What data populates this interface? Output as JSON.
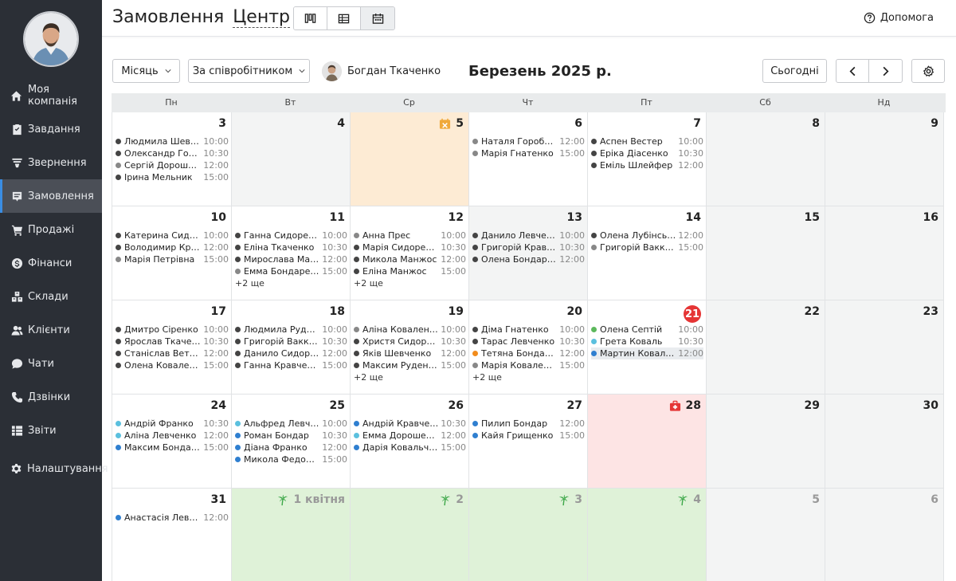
{
  "sidebar": {
    "items": [
      {
        "label": "Моя компанія",
        "icon": "home-icon"
      },
      {
        "label": "Завдання",
        "icon": "clipboard-icon"
      },
      {
        "label": "Звернення",
        "icon": "funnel-icon"
      },
      {
        "label": "Замовлення",
        "icon": "orders-icon",
        "active": true
      },
      {
        "label": "Продажі",
        "icon": "cart-icon"
      },
      {
        "label": "Фінанси",
        "icon": "dollar-icon"
      },
      {
        "label": "Склади",
        "icon": "boxes-icon"
      },
      {
        "label": "Клієнти",
        "icon": "users-icon"
      },
      {
        "label": "Чати",
        "icon": "chat-icon"
      },
      {
        "label": "Дзвінки",
        "icon": "phone-icon"
      },
      {
        "label": "Звіти",
        "icon": "reports-icon"
      },
      {
        "label": "Налаштування",
        "icon": "gear-icon"
      }
    ]
  },
  "header": {
    "title": "Замовлення",
    "location": "Центр",
    "help": "Допомога"
  },
  "toolbar": {
    "period": "Місяць",
    "grouping": "За співробітником",
    "employee": "Богдан Ткаченко",
    "month_title": "Березень 2025 р.",
    "today": "Сьогодні"
  },
  "calendar": {
    "weekdays": [
      "Пн",
      "Вт",
      "Ср",
      "Чт",
      "Пт",
      "Сб",
      "Нд"
    ],
    "weeks": [
      [
        {
          "day": "3",
          "events": [
            {
              "name": "Людмила Шевченко",
              "time": "10:00",
              "color": "#444"
            },
            {
              "name": "Олександр Гончар",
              "time": "10:30",
              "color": "#444"
            },
            {
              "name": "Сергій Дорошенко",
              "time": "12:00",
              "color": "#888"
            },
            {
              "name": "Ірина Мельник",
              "time": "15:00",
              "color": "#444"
            }
          ]
        },
        {
          "day": "4",
          "state": "past",
          "events": []
        },
        {
          "day": "5",
          "state": "vacation",
          "icon": "vacation-icon",
          "events": []
        },
        {
          "day": "6",
          "events": [
            {
              "name": "Наталя Горобець",
              "time": "12:00",
              "color": "#888"
            },
            {
              "name": "Марія Гнатенко",
              "time": "15:00",
              "color": "#888"
            }
          ]
        },
        {
          "day": "7",
          "events": [
            {
              "name": "Аспен Вестер",
              "time": "10:00",
              "color": "#444"
            },
            {
              "name": "Еріка Діасенко",
              "time": "10:30",
              "color": "#444"
            },
            {
              "name": "Еміль Шлейфер",
              "time": "12:00",
              "color": "#444"
            }
          ]
        },
        {
          "day": "8",
          "state": "weekend",
          "events": []
        },
        {
          "day": "9",
          "state": "weekend",
          "events": []
        }
      ],
      [
        {
          "day": "10",
          "events": [
            {
              "name": "Катерина Сидоренко",
              "time": "10:00",
              "color": "#444"
            },
            {
              "name": "Володимир Кравченко",
              "time": "12:00",
              "color": "#444"
            },
            {
              "name": "Марія Петрівна",
              "time": "15:00",
              "color": "#888"
            }
          ]
        },
        {
          "day": "11",
          "events": [
            {
              "name": "Ганна Сидоренко",
              "time": "10:00",
              "color": "#444"
            },
            {
              "name": "Еліна Ткаченко",
              "time": "10:30",
              "color": "#444"
            },
            {
              "name": "Мирослава Манжос",
              "time": "12:00",
              "color": "#444"
            },
            {
              "name": "Емма Бондаренко",
              "time": "15:00",
              "color": "#888"
            }
          ],
          "more": "+2 ще"
        },
        {
          "day": "12",
          "events": [
            {
              "name": "Анна Прес",
              "time": "10:00",
              "color": "#888"
            },
            {
              "name": "Марія Сидоренко",
              "time": "10:30",
              "color": "#444"
            },
            {
              "name": "Микола Манжос",
              "time": "12:00",
              "color": "#444"
            },
            {
              "name": "Еліна Манжос",
              "time": "15:00",
              "color": "#444"
            }
          ],
          "more": "+2 ще"
        },
        {
          "day": "13",
          "state": "past",
          "events": [
            {
              "name": "Данило Левченко",
              "time": "10:00",
              "color": "#444"
            },
            {
              "name": "Григорій Кравець",
              "time": "10:30",
              "color": "#444"
            },
            {
              "name": "Олена Бондаренко",
              "time": "12:00",
              "color": "#444"
            }
          ]
        },
        {
          "day": "14",
          "events": [
            {
              "name": "Олена Лубінська",
              "time": "12:00",
              "color": "#444"
            },
            {
              "name": "Григорій Ваккар",
              "time": "15:00",
              "color": "#888"
            }
          ]
        },
        {
          "day": "15",
          "state": "weekend",
          "events": []
        },
        {
          "day": "16",
          "state": "weekend",
          "events": []
        }
      ],
      [
        {
          "day": "17",
          "events": [
            {
              "name": "Дмитро Сіренко",
              "time": "10:00",
              "color": "#444"
            },
            {
              "name": "Ярослав Ткаченко",
              "time": "10:30",
              "color": "#444"
            },
            {
              "name": "Станіслав Ветров",
              "time": "12:00",
              "color": "#444"
            },
            {
              "name": "Олена Коваленко",
              "time": "15:00",
              "color": "#444"
            }
          ]
        },
        {
          "day": "18",
          "events": [
            {
              "name": "Людмила Руденко",
              "time": "10:00",
              "color": "#444"
            },
            {
              "name": "Григорій Ваккаро",
              "time": "10:30",
              "color": "#444"
            },
            {
              "name": "Данило Сидоренко",
              "time": "12:00",
              "color": "#444"
            },
            {
              "name": "Ганна Кравченко",
              "time": "15:00",
              "color": "#444"
            }
          ]
        },
        {
          "day": "19",
          "events": [
            {
              "name": "Аліна Коваленко",
              "time": "10:00",
              "color": "#888"
            },
            {
              "name": "Христя Сидоренко",
              "time": "10:30",
              "color": "#444"
            },
            {
              "name": "Яків Шевченко",
              "time": "12:00",
              "color": "#444"
            },
            {
              "name": "Максим Руденко",
              "time": "15:00",
              "color": "#444"
            }
          ],
          "more": "+2 ще"
        },
        {
          "day": "20",
          "events": [
            {
              "name": "Діма Гнатенко",
              "time": "10:00",
              "color": "#444"
            },
            {
              "name": "Тарас Левченко",
              "time": "10:30",
              "color": "#444"
            },
            {
              "name": "Тетяна Бондаренко",
              "time": "12:00",
              "color": "#f28c1c"
            },
            {
              "name": "Марія Коваленко",
              "time": "15:00",
              "color": "#888"
            }
          ],
          "more": "+2 ще"
        },
        {
          "day": "21",
          "today": true,
          "events": [
            {
              "name": "Олена Септій",
              "time": "10:00",
              "color": "#5cb85c"
            },
            {
              "name": "Грета Коваль",
              "time": "10:30",
              "color": "#5bc0de"
            },
            {
              "name": "Мартин Коваленко",
              "time": "12:00",
              "color": "#2f7fd0",
              "highlight": true
            }
          ]
        },
        {
          "day": "22",
          "state": "weekend",
          "events": []
        },
        {
          "day": "23",
          "state": "weekend",
          "events": []
        }
      ],
      [
        {
          "day": "24",
          "events": [
            {
              "name": "Андрій Франко",
              "time": "10:30",
              "color": "#5bc0de"
            },
            {
              "name": "Аліна Левченко",
              "time": "12:00",
              "color": "#5bc0de"
            },
            {
              "name": "Максим Бондаренко",
              "time": "15:00",
              "color": "#2f7fd0"
            }
          ]
        },
        {
          "day": "25",
          "events": [
            {
              "name": "Альфред Левченко",
              "time": "10:00",
              "color": "#5bc0de"
            },
            {
              "name": "Роман Бондар",
              "time": "10:30",
              "color": "#2f7fd0"
            },
            {
              "name": "Діана Франко",
              "time": "12:00",
              "color": "#2f7fd0"
            },
            {
              "name": "Микола Федоренко",
              "time": "15:00",
              "color": "#2f7fd0"
            }
          ]
        },
        {
          "day": "26",
          "events": [
            {
              "name": "Андрій Кравченко",
              "time": "10:30",
              "color": "#2f7fd0"
            },
            {
              "name": "Емма Дорошенко",
              "time": "12:00",
              "color": "#5bc0de"
            },
            {
              "name": "Дарія Ковальчук",
              "time": "15:00",
              "color": "#2f7fd0"
            }
          ]
        },
        {
          "day": "27",
          "events": [
            {
              "name": "Пилип Бондар",
              "time": "12:00",
              "color": "#2f7fd0"
            },
            {
              "name": "Кайя Грищенко",
              "time": "15:00",
              "color": "#2f7fd0"
            }
          ]
        },
        {
          "day": "28",
          "state": "sick",
          "icon": "medical-kit-icon",
          "events": []
        },
        {
          "day": "29",
          "state": "weekend",
          "events": []
        },
        {
          "day": "30",
          "state": "weekend",
          "events": []
        }
      ],
      [
        {
          "day": "31",
          "events": [
            {
              "name": "Анастасія Левченко",
              "time": "12:00",
              "color": "#2f7fd0"
            }
          ]
        },
        {
          "day": "1 квітня",
          "state": "holiday",
          "other": true,
          "icon": "palm-tree-icon",
          "events": []
        },
        {
          "day": "2",
          "state": "holiday",
          "other": true,
          "icon": "palm-tree-icon",
          "events": []
        },
        {
          "day": "3",
          "state": "holiday",
          "other": true,
          "icon": "palm-tree-icon",
          "events": []
        },
        {
          "day": "4",
          "state": "holiday",
          "other": true,
          "icon": "palm-tree-icon",
          "events": []
        },
        {
          "day": "5",
          "state": "weekend",
          "other": true,
          "events": []
        },
        {
          "day": "6",
          "state": "weekend",
          "other": true,
          "events": []
        }
      ]
    ]
  }
}
